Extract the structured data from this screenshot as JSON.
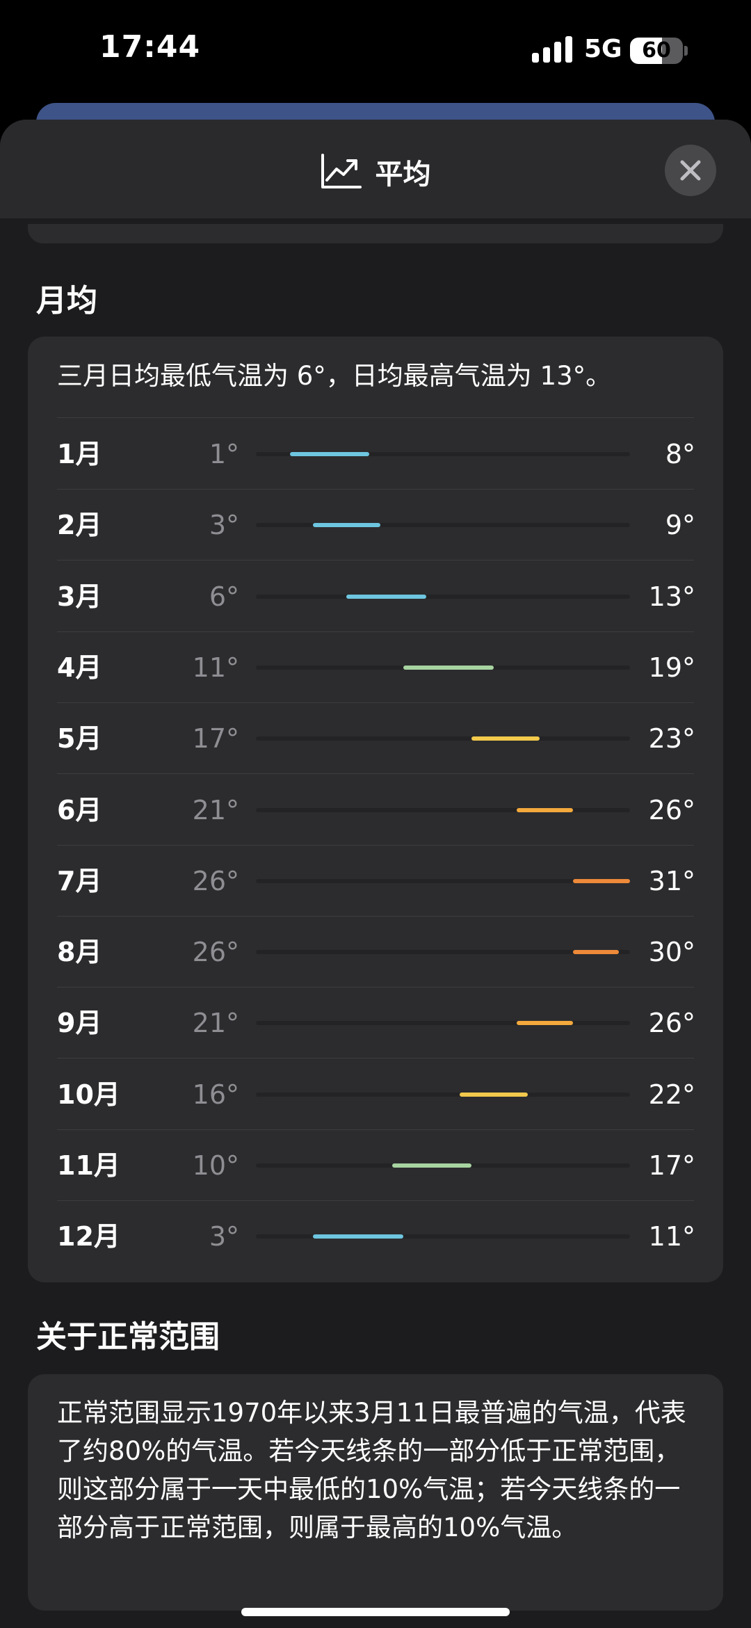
{
  "status": {
    "time": "17:44",
    "network": "5G",
    "battery": "60",
    "battery_level": 0.6
  },
  "header": {
    "title": "平均",
    "icon": "chart-line-up-icon",
    "close_icon": "close-icon"
  },
  "monthly": {
    "heading": "月均",
    "summary": "三月日均最低气温为 6°，日均最高气温为 13°。",
    "scale_min": -2,
    "scale_max": 31,
    "rows": [
      {
        "month": "1月",
        "low": "1°",
        "high": "8°",
        "lo_val": 1,
        "hi_val": 8,
        "color": "#6ec6e0"
      },
      {
        "month": "2月",
        "low": "3°",
        "high": "9°",
        "lo_val": 3,
        "hi_val": 9,
        "color": "#6ec6e0"
      },
      {
        "month": "3月",
        "low": "6°",
        "high": "13°",
        "lo_val": 6,
        "hi_val": 13,
        "color": "#6ec6e0"
      },
      {
        "month": "4月",
        "low": "11°",
        "high": "19°",
        "lo_val": 11,
        "hi_val": 19,
        "color": "#a8d4a1"
      },
      {
        "month": "5月",
        "low": "17°",
        "high": "23°",
        "lo_val": 17,
        "hi_val": 23,
        "color": "#f2c94c"
      },
      {
        "month": "6月",
        "low": "21°",
        "high": "26°",
        "lo_val": 21,
        "hi_val": 26,
        "color": "#f3a93c"
      },
      {
        "month": "7月",
        "low": "26°",
        "high": "31°",
        "lo_val": 26,
        "hi_val": 31,
        "color": "#ee8a3a"
      },
      {
        "month": "8月",
        "low": "26°",
        "high": "30°",
        "lo_val": 26,
        "hi_val": 30,
        "color": "#ee8a3a"
      },
      {
        "month": "9月",
        "low": "21°",
        "high": "26°",
        "lo_val": 21,
        "hi_val": 26,
        "color": "#f3a93c"
      },
      {
        "month": "10月",
        "low": "16°",
        "high": "22°",
        "lo_val": 16,
        "hi_val": 22,
        "color": "#f2c94c"
      },
      {
        "month": "11月",
        "low": "10°",
        "high": "17°",
        "lo_val": 10,
        "hi_val": 17,
        "color": "#a8d4a1"
      },
      {
        "month": "12月",
        "low": "3°",
        "high": "11°",
        "lo_val": 3,
        "hi_val": 11,
        "color": "#6ec6e0"
      }
    ]
  },
  "about": {
    "heading": "关于正常范围",
    "text": "正常范围显示1970年以来3月11日最普遍的气温，代表了约80%的气温。若今天线条的一部分低于正常范围，则这部分属于一天中最低的10%气温；若今天线条的一部分高于正常范围，则属于最高的10%气温。"
  }
}
